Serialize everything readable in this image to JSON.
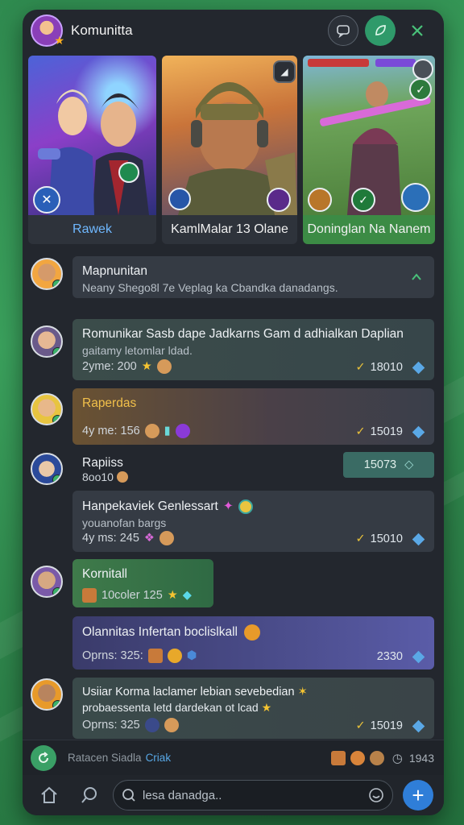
{
  "header": {
    "title": "Komunitta"
  },
  "cards": [
    {
      "label": "Rawek",
      "label_color": "#6fb8ff"
    },
    {
      "label": "KamlMalar 13 Olane",
      "label_color": "#f0f0f0"
    },
    {
      "label": "Doninglan Na Nanem",
      "label_color": "#f0f0f0"
    }
  ],
  "feed": {
    "posts": [
      {
        "title": "Mapnunitan",
        "subtitle": "Neany Shego8l 7e Veplag ka Cbandka danadangs."
      },
      {
        "title": "Romunikar Sasb dape Jadkarns Gam d adhialkan Daplian",
        "subtitle": "gaitamy letomlar ldad.",
        "meta": "2yme: 200",
        "score": "18010"
      },
      {
        "title": "Raperdas",
        "meta": "4y me: 156",
        "score": "15019"
      },
      {
        "title": "Rapiiss",
        "subtitle": "8oo10",
        "pill": "15073"
      },
      {
        "title": "Hanpekaviek Genlessart",
        "subtitle": "youanofan bargs",
        "meta": "4y ms: 245",
        "score": "15010"
      },
      {
        "title": "Kornitall",
        "meta": "10coler 125"
      },
      {
        "title": "Olannitas Infertan boclislkall",
        "meta": "Oprns: 325:",
        "score": "2330"
      },
      {
        "title": "Usiiar Korma laclamer lebian sevebedian",
        "subtitle": "probaessenta letd dardekan ot lcad",
        "meta": "Oprns: 325",
        "score": "15019"
      }
    ]
  },
  "bottom_bar": {
    "text": "Ratacen Siadla",
    "link": "Criak",
    "count": "1943"
  },
  "nav": {
    "search_placeholder": "lesa danadga.."
  },
  "colors": {
    "accent_green": "#3aa066",
    "accent_blue": "#2f7ed8",
    "window_bg": "#23272e"
  }
}
